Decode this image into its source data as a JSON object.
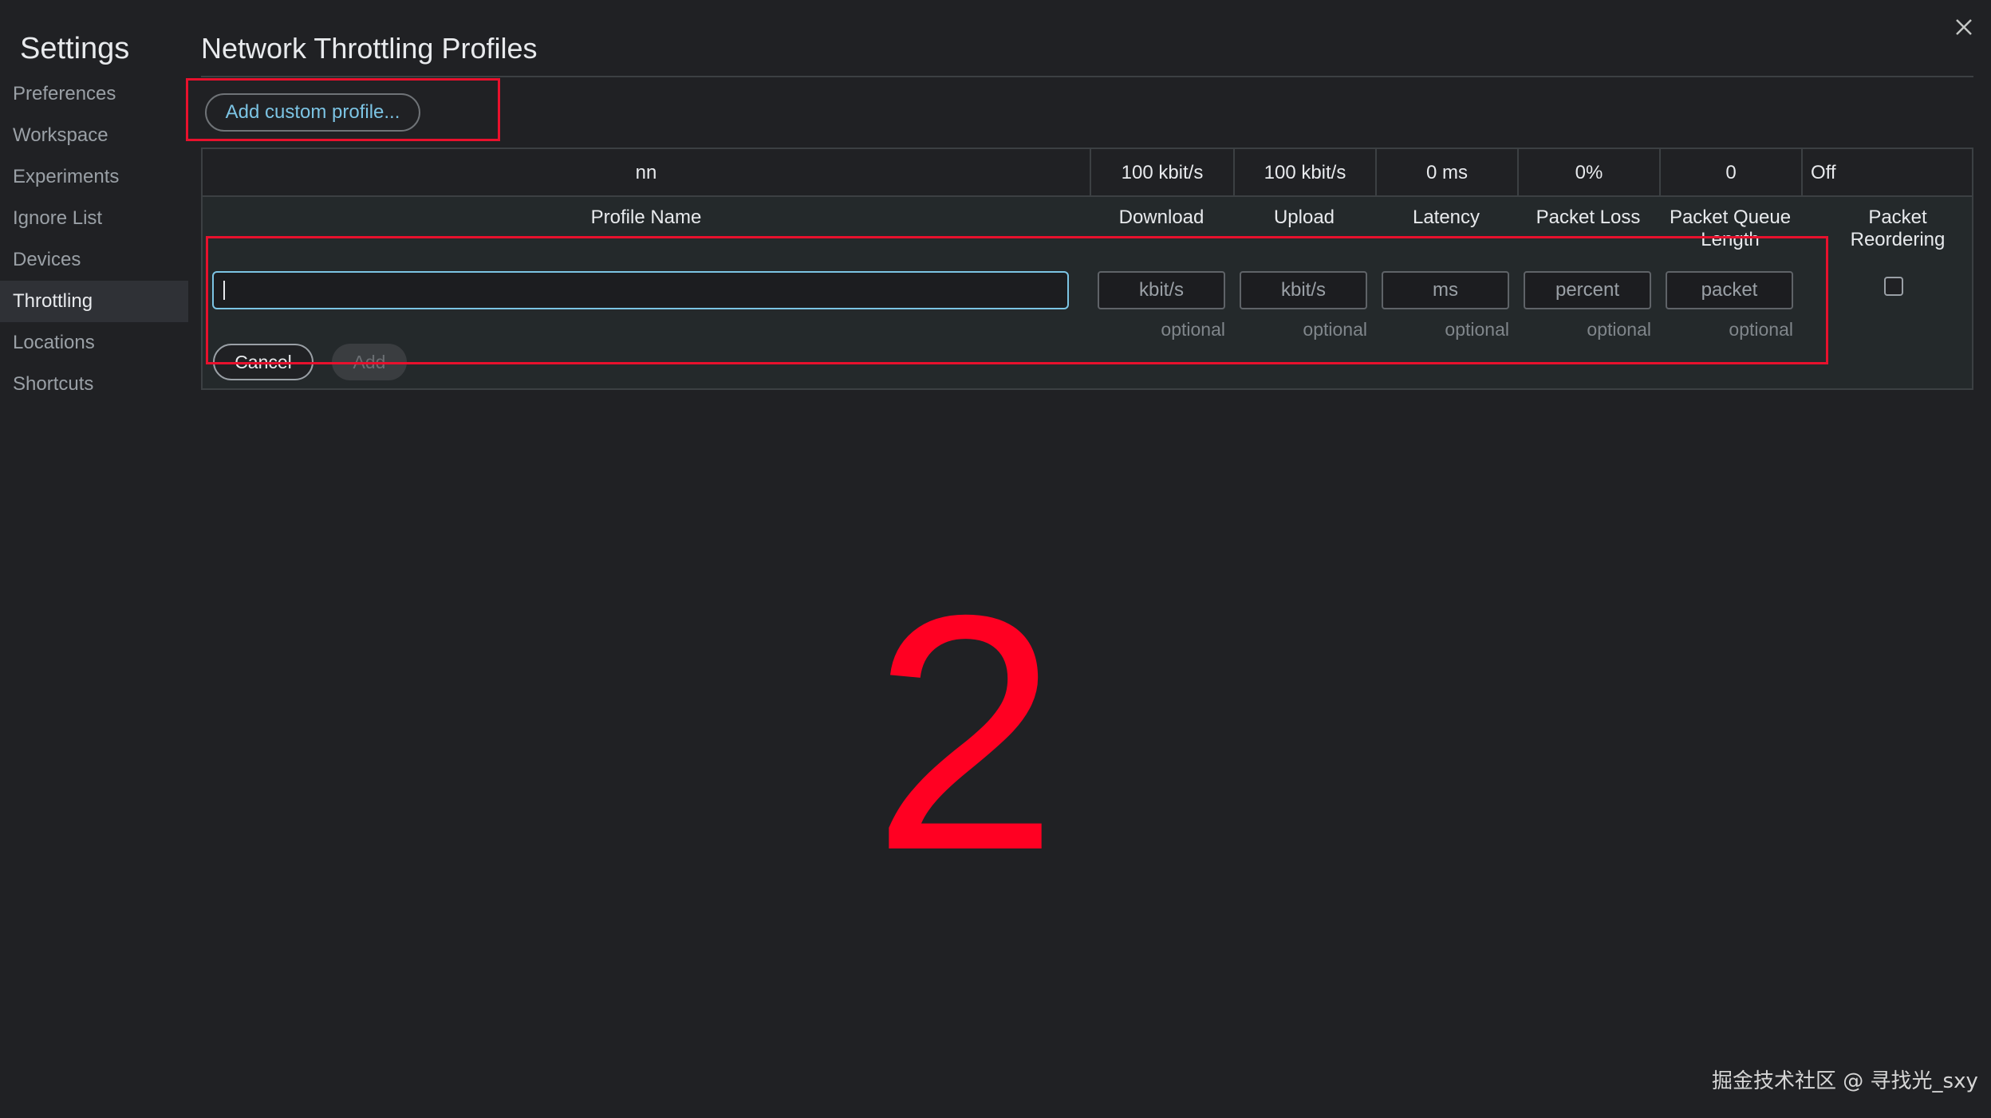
{
  "sidebar": {
    "title": "Settings",
    "items": [
      {
        "label": "Preferences"
      },
      {
        "label": "Workspace"
      },
      {
        "label": "Experiments"
      },
      {
        "label": "Ignore List"
      },
      {
        "label": "Devices"
      },
      {
        "label": "Throttling",
        "selected": true
      },
      {
        "label": "Locations"
      },
      {
        "label": "Shortcuts"
      }
    ]
  },
  "header": {
    "title": "Network Throttling Profiles",
    "close_icon": "close-icon"
  },
  "actions": {
    "add_custom_profile": "Add custom profile..."
  },
  "profile_row": {
    "name": "nn",
    "download": "100 kbit/s",
    "upload": "100 kbit/s",
    "latency": "0 ms",
    "packet_loss": "0%",
    "packet_queue_length": "0",
    "packet_reordering": "Off"
  },
  "columns": {
    "profile_name": "Profile Name",
    "download": "Download",
    "upload": "Upload",
    "latency": "Latency",
    "packet_loss": "Packet Loss",
    "packet_queue_length": "Packet Queue Length",
    "packet_reordering": "Packet Reordering"
  },
  "editor": {
    "name_value": "",
    "download_placeholder": "kbit/s",
    "upload_placeholder": "kbit/s",
    "latency_placeholder": "ms",
    "packet_loss_placeholder": "percent",
    "packet_queue_placeholder": "packet",
    "optional_hint": "optional",
    "packet_reordering_checked": false,
    "cancel_label": "Cancel",
    "add_label": "Add"
  },
  "annotation": {
    "step_number": "2",
    "highlight_color": "#e8112d"
  },
  "watermark": "掘金技术社区 @ 寻找光_sxy",
  "colors": {
    "background": "#202124",
    "accent": "#7cc4e4",
    "annotation_red": "#ff0022"
  }
}
